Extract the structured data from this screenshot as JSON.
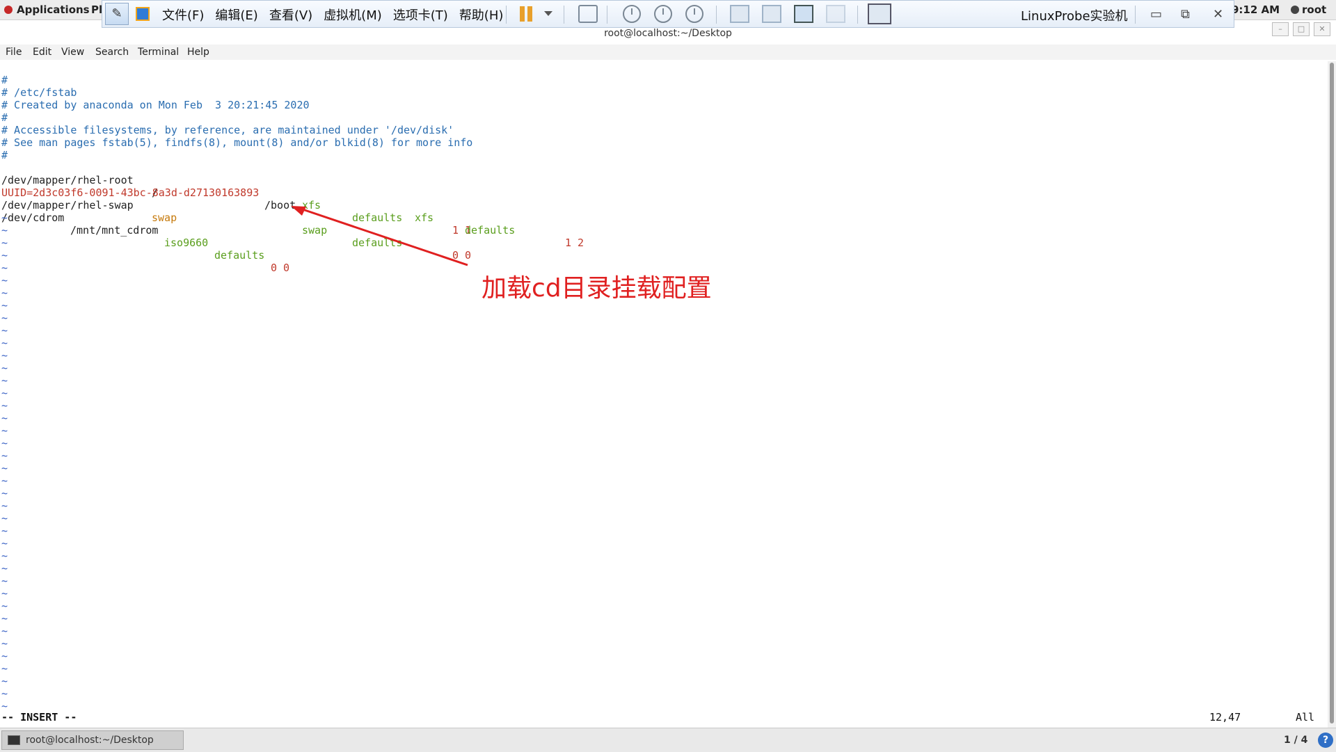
{
  "topbar": {
    "applications": "Applications",
    "places": "Pl",
    "clock": "9:12 AM",
    "user": "root"
  },
  "vmware": {
    "menus": [
      "文件(F)",
      "编辑(E)",
      "查看(V)",
      "虚拟机(M)",
      "选项卡(T)",
      "帮助(H)"
    ],
    "title": "LinuxProbe实验机"
  },
  "window": {
    "title": "root@localhost:~/Desktop"
  },
  "terminal_menu": [
    "File",
    "Edit",
    "View",
    "Search",
    "Terminal",
    "Help"
  ],
  "editor": {
    "comments": [
      "#",
      "# /etc/fstab",
      "# Created by anaconda on Mon Feb  3 20:21:45 2020",
      "#",
      "# Accessible filesystems, by reference, are maintained under '/dev/disk'",
      "# See man pages fstab(5), findfs(8), mount(8) and/or blkid(8) for more info",
      "#"
    ],
    "root_line": {
      "device": "/dev/mapper/rhel-root",
      "mount": "/",
      "fs": "xfs",
      "opts": "defaults",
      "nums": "1 1"
    },
    "boot_line": {
      "device": "UUID=2d3c03f6-0091-43bc-8a3d-d27130163893",
      "mount": "/boot",
      "fs": "xfs",
      "opts": "defaults",
      "nums": "1 2"
    },
    "swap_line": {
      "device": "/dev/mapper/rhel-swap",
      "mount": "swap",
      "fs": "swap",
      "opts": "defaults",
      "nums": "0 0"
    },
    "cdrom_line": {
      "device": "/dev/cdrom",
      "mount": "/mnt/mnt_cdrom",
      "fs": "iso9660",
      "opts": "defaults",
      "nums": "0 0"
    },
    "tilde": "~",
    "mode": "-- INSERT --",
    "cursor": "12,47",
    "scroll": "All"
  },
  "annotation": {
    "text": "加载cd目录挂载配置",
    "color": "#e02020"
  },
  "taskbar": {
    "window": "root@localhost:~/Desktop",
    "pager": "1 / 4",
    "help": "?"
  }
}
